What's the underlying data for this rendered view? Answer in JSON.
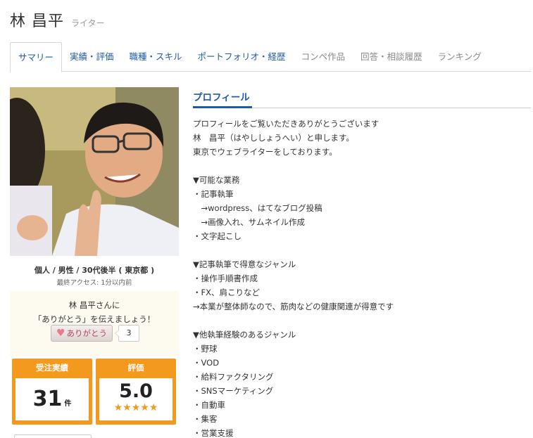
{
  "header": {
    "name": "林 昌平",
    "role": "ライター"
  },
  "tabs": [
    {
      "label": "サマリー",
      "state": "active"
    },
    {
      "label": "実績・評価",
      "state": "link"
    },
    {
      "label": "職種・スキル",
      "state": "link"
    },
    {
      "label": "ポートフォリオ・経歴",
      "state": "link"
    },
    {
      "label": "コンペ作品",
      "state": "muted"
    },
    {
      "label": "回答・相談履歴",
      "state": "muted"
    },
    {
      "label": "ランキング",
      "state": "muted"
    }
  ],
  "profile": {
    "meta": "個人 / 男性 / 30代後半 ( 東京都 )",
    "last_access": "最終アクセス: 1分以内前"
  },
  "thanks": {
    "line1": "林 昌平さんに",
    "line2": "「ありがとう」を伝えましょう！",
    "button_label": "ありがとう",
    "count": "3"
  },
  "stats": {
    "orders_title": "受注実績",
    "orders_value": "31",
    "orders_unit": "件",
    "rating_title": "評価",
    "rating_value": "5.0",
    "stars": "★★★★★",
    "star_color": "#f39a1e"
  },
  "section": {
    "title": "プロフィール"
  },
  "profile_text": [
    "プロフィールをご覧いただきありがとうございます",
    "林　昌平（はやししょうへい）と申します。",
    "東京でウェブライターをしております。",
    "",
    "▼可能な業務",
    "・記事執筆",
    "　→wordpress、はてなブログ投稿",
    "　→画像入れ、サムネイル作成",
    "・文字起こし",
    "",
    "▼記事執筆で得意なジャンル",
    "・操作手順書作成",
    "・FX、肩こりなど",
    "→本業が整体師なので、筋肉などの健康関連が得意です",
    "",
    "▼他執筆経験のあるジャンル",
    "・野球",
    "・VOD",
    "・給料ファクタリング",
    "・SNSマーケティング",
    "・自動車",
    "・集客",
    "・営業支援"
  ],
  "colors": {
    "accent": "#1e5aa8",
    "stat_orange": "#f39a1e"
  }
}
